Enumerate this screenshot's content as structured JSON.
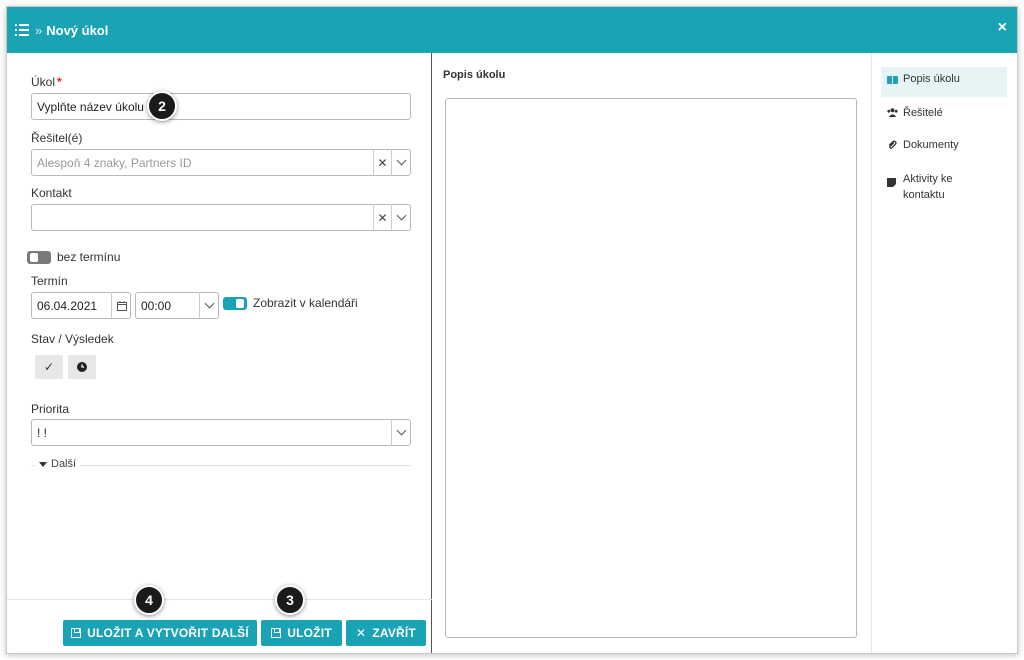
{
  "window": {
    "title": "Nový úkol",
    "breadcrumb_sep": "»",
    "close": "×"
  },
  "form": {
    "task_label": "Úkol",
    "task_required": "*",
    "task_value": "Vyplňte název úkolu",
    "resolver_label": "Řešitel(é)",
    "resolver_placeholder": "Alespoň 4 znaky, Partners ID",
    "contact_label": "Kontakt",
    "contact_value": "",
    "no_deadline_label": "bez termínu",
    "deadline_label": "Termín",
    "date_value": "06.04.2021",
    "time_value": "00:00",
    "show_calendar_label": "Zobrazit v kalendáři",
    "status_label": "Stav / Výsledek",
    "priority_label": "Priorita",
    "priority_value": "! !",
    "more_label": "Další"
  },
  "footer": {
    "save_new_label": "ULOŽIT A VYTVOŘIT DALŠÍ",
    "save_label": "ULOŽIT",
    "close_label": "ZAVŘÍT"
  },
  "description": {
    "title": "Popis úkolu"
  },
  "sidenav": {
    "items": [
      {
        "label": "Popis úkolu",
        "icon": "book-icon",
        "active": true
      },
      {
        "label": "Řešitelé",
        "icon": "users-icon",
        "active": false
      },
      {
        "label": "Dokumenty",
        "icon": "paperclip-icon",
        "active": false
      },
      {
        "label": "Aktivity ke kontaktu",
        "icon": "note-icon",
        "active": false
      }
    ]
  },
  "callouts": {
    "task": "2",
    "save": "3",
    "save_new": "4"
  },
  "colors": {
    "accent": "#1aa3b4",
    "toggle_off": "#7a7a7a",
    "required": "#e02020"
  }
}
